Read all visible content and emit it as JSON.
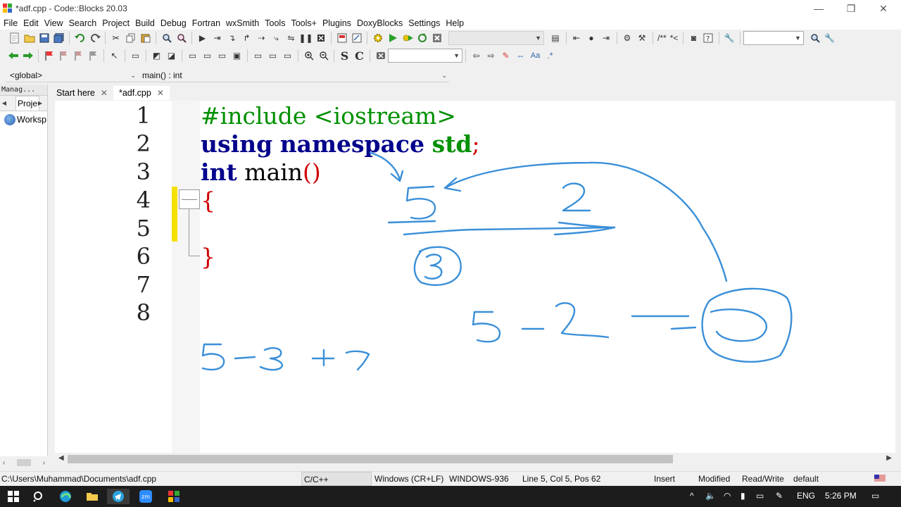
{
  "window": {
    "title": "*adf.cpp - Code::Blocks 20.03"
  },
  "menu": [
    "File",
    "Edit",
    "View",
    "Search",
    "Project",
    "Build",
    "Debug",
    "Fortran",
    "wxSmith",
    "Tools",
    "Tools+",
    "Plugins",
    "DoxyBlocks",
    "Settings",
    "Help"
  ],
  "toolbar": {
    "comment_label": "/**",
    "doc_label": "*<",
    "bold_s": "S",
    "bold_c": "C",
    "aa_label": "Aa"
  },
  "scope": {
    "global": "<global>",
    "function": "main() : int"
  },
  "management": {
    "header": "Manag...",
    "projects_tab": "Proje",
    "workspace": "Worksp"
  },
  "editor_tabs": [
    {
      "label": "Start here"
    },
    {
      "label": "*adf.cpp"
    }
  ],
  "code": {
    "line_numbers": [
      "1",
      "2",
      "3",
      "4",
      "5",
      "6",
      "7",
      "8"
    ],
    "line1": {
      "pre": "#include <iostream>"
    },
    "line2": {
      "using": "using",
      "namespace": "namespace",
      "std": "std",
      "semi": ";"
    },
    "line3": {
      "int": "int",
      "main": " main",
      "parens": "()"
    },
    "line4": {
      "brace": "{"
    },
    "line6": {
      "brace": "}"
    }
  },
  "status": {
    "path": "C:\\Users\\Muhammad\\Documents\\adf.cpp",
    "language": "C/C++",
    "eol": "Windows (CR+LF)",
    "encoding": "WINDOWS-936",
    "position": "Line 5, Col 5, Pos 62",
    "mode": "Insert",
    "modified": "Modified",
    "access": "Read/Write",
    "profile": "default"
  },
  "taskbar": {
    "lang": "ENG",
    "time": "5:26 PM"
  },
  "colors": {
    "preprocessor": "#009000",
    "keyword": "#00008b",
    "punctuation": "#d00000",
    "ink": "#3a8fd8",
    "change_bar": "#f5e000"
  }
}
